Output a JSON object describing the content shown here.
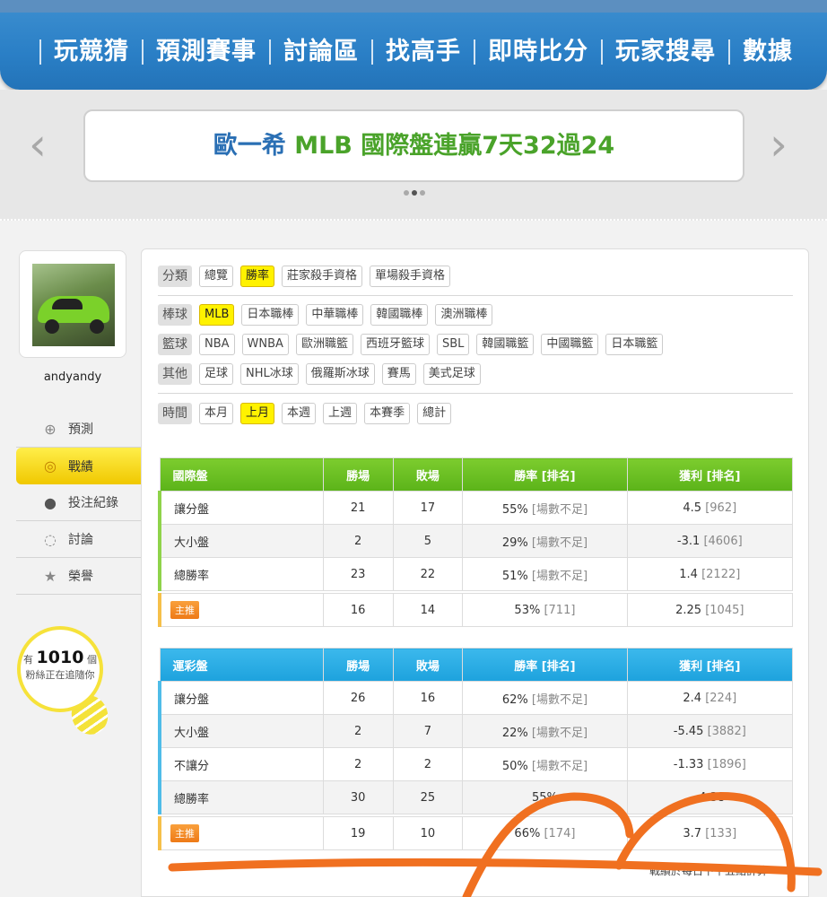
{
  "nav": {
    "items": [
      "玩競猜",
      "預測賽事",
      "討論區",
      "找高手",
      "即時比分",
      "玩家搜尋",
      "數據"
    ]
  },
  "banner": {
    "prefix": "歐一希 ",
    "highlight": "MLB 國際盤連贏7天32過24",
    "prev_icon": "chevron-left-icon",
    "next_icon": "chevron-right-icon"
  },
  "profile": {
    "username": "andyandy",
    "avatar": "green-sports-car-photo"
  },
  "side_menu": [
    {
      "label": "預測",
      "icon": "crosshair-icon"
    },
    {
      "label": "戰績",
      "icon": "medal-icon",
      "active": true
    },
    {
      "label": "投注紀錄",
      "icon": "circle-icon"
    },
    {
      "label": "討論",
      "icon": "chat-icon"
    },
    {
      "label": "榮譽",
      "icon": "trophy-icon"
    }
  ],
  "fans": {
    "prefix": "有",
    "count": "1010",
    "unit": "個",
    "text": "粉絲正在追隨你"
  },
  "filters": {
    "category": {
      "label": "分類",
      "options": [
        "總覽",
        "勝率",
        "莊家殺手資格",
        "單場殺手資格"
      ],
      "selected": "勝率"
    },
    "baseball": {
      "label": "棒球",
      "options": [
        "MLB",
        "日本職棒",
        "中華職棒",
        "韓國職棒",
        "澳洲職棒"
      ],
      "selected": "MLB"
    },
    "basketball": {
      "label": "籃球",
      "options": [
        "NBA",
        "WNBA",
        "歐洲職籃",
        "西班牙籃球",
        "SBL",
        "韓國職籃",
        "中國職籃",
        "日本職籃"
      ]
    },
    "other": {
      "label": "其他",
      "options": [
        "足球",
        "NHL冰球",
        "俄羅斯冰球",
        "賽馬",
        "美式足球"
      ]
    },
    "time": {
      "label": "時間",
      "options": [
        "本月",
        "上月",
        "本週",
        "上週",
        "本賽季",
        "總計"
      ],
      "selected": "上月"
    }
  },
  "table1": {
    "headers": [
      "國際盤",
      "勝場",
      "敗場",
      "勝率 [排名]",
      "獲利 [排名]"
    ],
    "rows": [
      {
        "name": "讓分盤",
        "win": "21",
        "lose": "17",
        "rate": "55%",
        "rate_rank": "[場數不足]",
        "profit": "4.5",
        "profit_rank": "[962]"
      },
      {
        "name": "大小盤",
        "win": "2",
        "lose": "5",
        "rate": "29%",
        "rate_rank": "[場數不足]",
        "profit": "-3.1",
        "profit_rank": "[4606]"
      },
      {
        "name": "總勝率",
        "win": "23",
        "lose": "22",
        "rate": "51%",
        "rate_rank": "[場數不足]",
        "profit": "1.4",
        "profit_rank": "[2122]"
      }
    ],
    "star": {
      "name": "主推",
      "win": "16",
      "lose": "14",
      "rate": "53%",
      "rate_rank": "[711]",
      "profit": "2.25",
      "profit_rank": "[1045]"
    }
  },
  "table2": {
    "headers": [
      "運彩盤",
      "勝場",
      "敗場",
      "勝率 [排名]",
      "獲利 [排名]"
    ],
    "rows": [
      {
        "name": "讓分盤",
        "win": "26",
        "lose": "16",
        "rate": "62%",
        "rate_rank": "[場數不足]",
        "profit": "2.4",
        "profit_rank": "[224]"
      },
      {
        "name": "大小盤",
        "win": "2",
        "lose": "7",
        "rate": "22%",
        "rate_rank": "[場數不足]",
        "profit": "-5.45",
        "profit_rank": "[3882]"
      },
      {
        "name": "不讓分",
        "win": "2",
        "lose": "2",
        "rate": "50%",
        "rate_rank": "[場數不足]",
        "profit": "-1.33",
        "profit_rank": "[1896]"
      },
      {
        "name": "總勝率",
        "win": "30",
        "lose": "25",
        "rate": "55%",
        "rate_rank": "",
        "profit": "-4.38",
        "profit_rank": ""
      }
    ],
    "star": {
      "name": "主推",
      "win": "19",
      "lose": "10",
      "rate": "66%",
      "rate_rank": "[174]",
      "profit": "3.7",
      "profit_rank": "[133]"
    }
  },
  "footer_note": "戰績於每日下午五點計算",
  "colors": {
    "nav": "#2a7fc6",
    "accent_yellow": "#fff200",
    "table1_header": "#5bb319",
    "table2_header": "#1da2dd",
    "scribble": "#f07020"
  }
}
